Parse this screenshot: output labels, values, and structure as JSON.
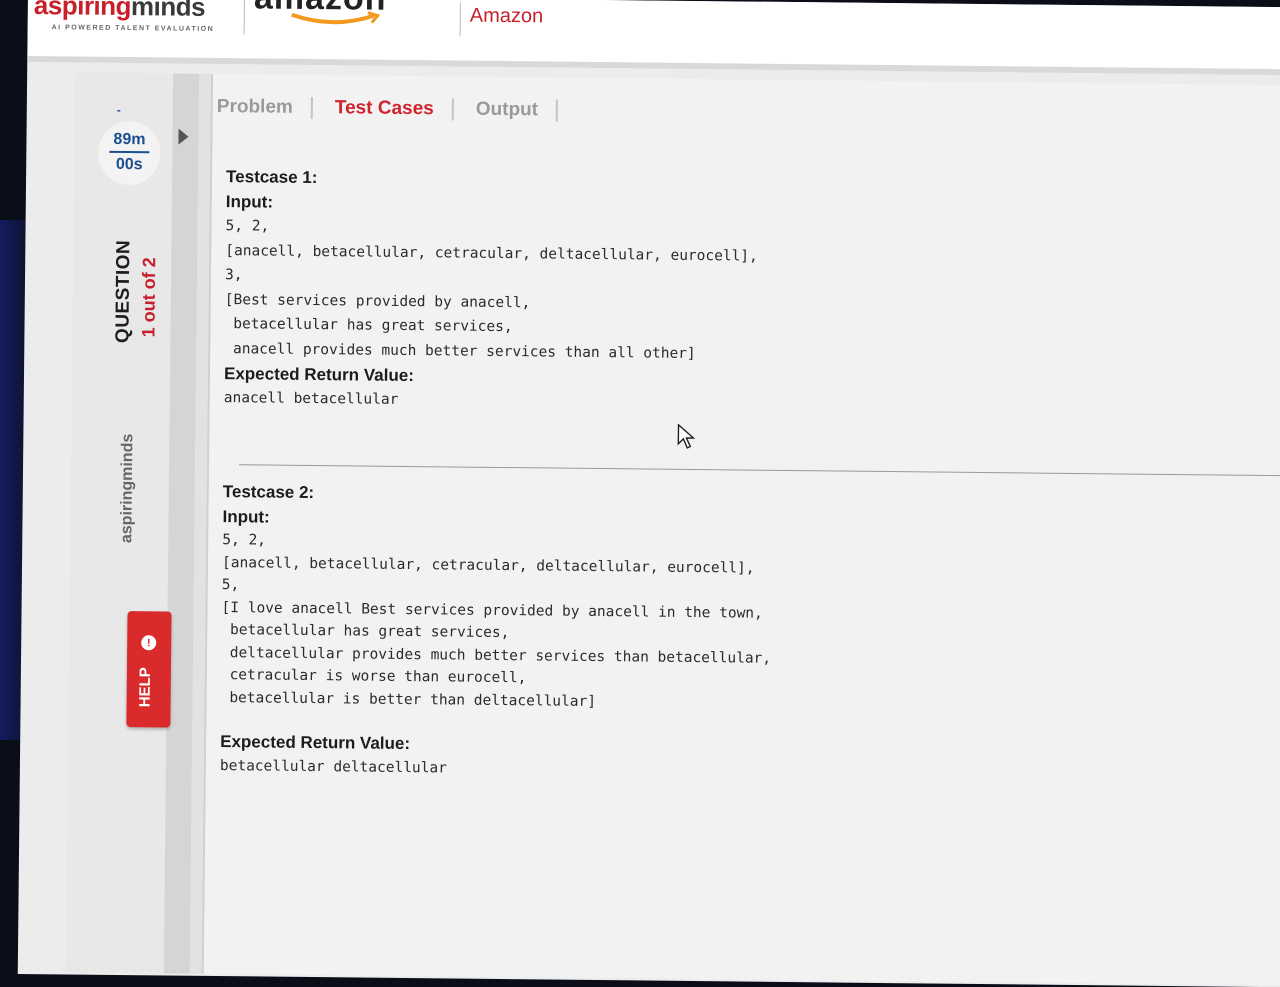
{
  "header": {
    "logo_primary": "aspiring",
    "logo_secondary": "minds",
    "logo_tagline": "AI POWERED TALENT EVALUATION",
    "brand_mark": "amazon",
    "company": "Amazon"
  },
  "sidebar": {
    "timer_dash": "-",
    "timer_minutes": "89m",
    "timer_seconds": "00s",
    "question_label": "QUESTION",
    "question_count": "1 out of 2",
    "logo_text": "aspiringminds",
    "help_label": "HELP"
  },
  "tabs": [
    {
      "label": "Problem",
      "active": false
    },
    {
      "label": "Test Cases",
      "active": true
    },
    {
      "label": "Output",
      "active": false
    }
  ],
  "testcases": [
    {
      "title": "Testcase 1:",
      "input_label": "Input:",
      "input_lines": [
        "5, 2,",
        "[anacell, betacellular, cetracular, deltacellular, eurocell],",
        "3,",
        "[Best services provided by anacell,",
        " betacellular has great services,",
        " anacell provides much better services than all other]"
      ],
      "expected_label": "Expected Return Value:",
      "expected_value": "anacell betacellular"
    },
    {
      "title": "Testcase 2:",
      "input_label": "Input:",
      "input_lines": [
        "5, 2,",
        "[anacell, betacellular, cetracular, deltacellular, eurocell],",
        "5,",
        "[I love anacell Best services provided by anacell in the town,",
        " betacellular has great services,",
        " deltacellular provides much better services than betacellular,",
        " cetracular is worse than eurocell,",
        " betacellular is better than deltacellular]"
      ],
      "expected_label": "Expected Return Value:",
      "expected_value": "betacellular deltacellular"
    }
  ],
  "colors": {
    "brand_red": "#c8202b",
    "timer_blue": "#1d4f8f",
    "help_red": "#d92b2b"
  }
}
